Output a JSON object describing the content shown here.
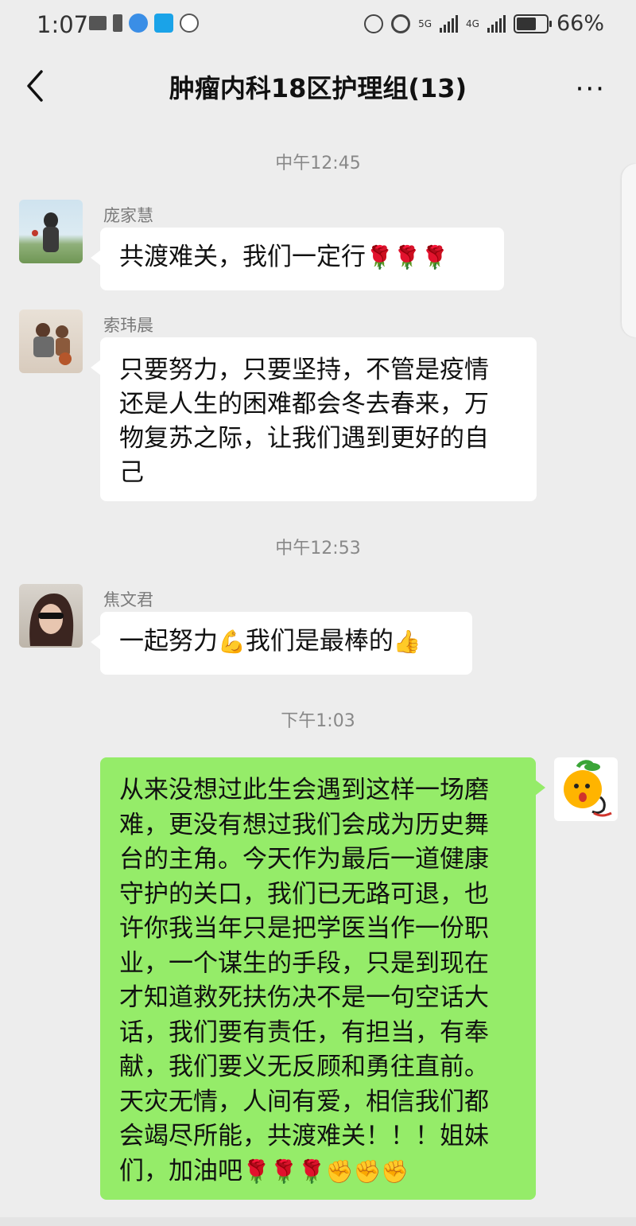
{
  "status_bar": {
    "time": "1:07",
    "battery_percent": "66%",
    "battery_level": 0.66,
    "network_left": "5G",
    "network_right": "4G",
    "icons_left": [
      "mail-icon",
      "sim-icon",
      "browser-icon",
      "search-app-icon",
      "hand-icon"
    ],
    "icons_right": [
      "data-icon",
      "alarm-icon",
      "signal-icon",
      "signal-icon",
      "battery-icon"
    ]
  },
  "header": {
    "title": "肿瘤内科18区护理组(13)",
    "back_icon": "chevron-left-icon",
    "more_label": "···"
  },
  "messages": {
    "ts1": "中午12:45",
    "m1": {
      "sender": "庞家慧",
      "text": "共渡难关，我们一定行",
      "emoji": "🌹🌹🌹"
    },
    "m2": {
      "sender": "索玮晨",
      "lines": [
        "只要努力，只要坚持，不管是疫情",
        "还是人生的困难都会冬去春来，万",
        "物复苏之际，让我们遇到更好的自",
        "己"
      ]
    },
    "ts2": "中午12:53",
    "m3": {
      "sender": "焦文君",
      "text_a": "一起努力",
      "emoji_a": "💪",
      "text_b": "我们是最棒的",
      "emoji_b": "👍"
    },
    "ts3": "下午1:03",
    "m4": {
      "lines": [
        "从来没想过此生会遇到这样一场磨",
        "难，更没有想过我们会成为历史舞",
        "台的主角。今天作为最后一道健康",
        "守护的关口，我们已无路可退，也",
        "许你我当年只是把学医当作一份职",
        "业，一个谋生的手段，只是到现在",
        "才知道救死扶伤决不是一句空话大",
        "话，我们要有责任，有担当，有奉",
        "献，我们要义无反顾和勇往直前。",
        "天灾无情，人间有爱，相信我们都",
        "会竭尽所能，共渡难关！！！姐妹"
      ],
      "last_line_text": "们，加油吧",
      "last_line_emoji": "🌹🌹🌹✊✊✊"
    }
  },
  "colors": {
    "background": "#ededed",
    "bubble_in": "#ffffff",
    "bubble_out": "#95ec69",
    "timestamp": "#888888"
  }
}
